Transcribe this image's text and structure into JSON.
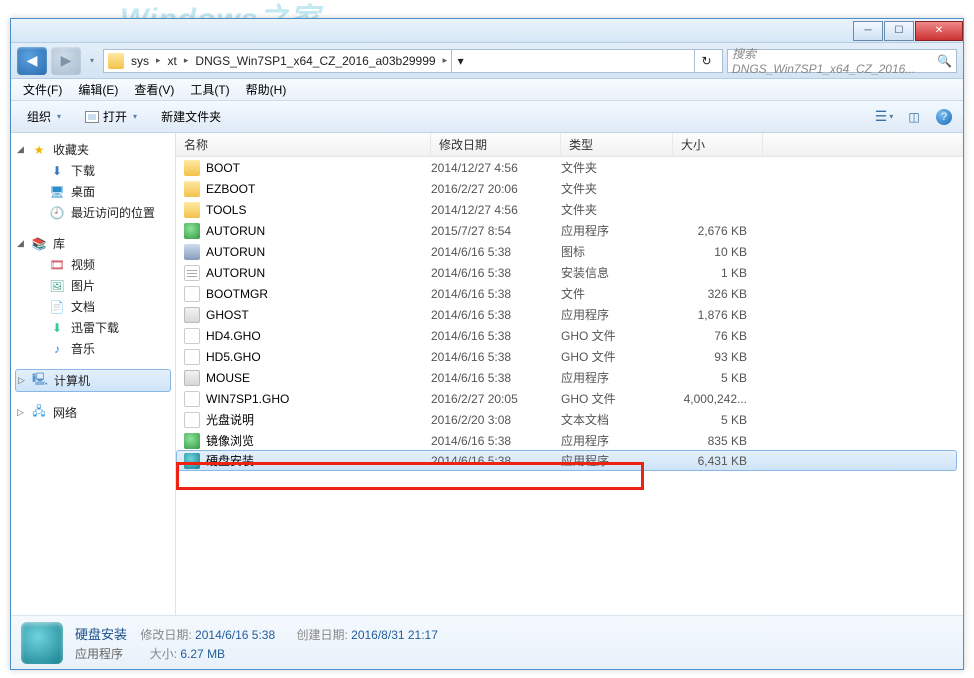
{
  "backdrop1": "Windows之家",
  "titlebar": {
    "min": "─",
    "max": "☐",
    "close": "✕"
  },
  "nav": {
    "back": "◀",
    "forward": "▶",
    "drop": "▾",
    "refresh": "↻",
    "search_placeholder": "搜索 DNGS_Win7SP1_x64_CZ_2016..."
  },
  "breadcrumb": {
    "items": [
      "sys",
      "xt",
      "DNGS_Win7SP1_x64_CZ_2016_a03b29999"
    ],
    "sep": "▸"
  },
  "menubar": {
    "file": "文件(F)",
    "edit": "编辑(E)",
    "view": "查看(V)",
    "tools": "工具(T)",
    "help": "帮助(H)"
  },
  "toolbar": {
    "organize": "组织",
    "open": "打开",
    "newfolder": "新建文件夹",
    "view_drop": "▾",
    "help": "?"
  },
  "sidebar": {
    "favorites": "收藏夹",
    "downloads": "下载",
    "desktop": "桌面",
    "recent": "最近访问的位置",
    "libraries": "库",
    "videos": "视频",
    "pictures": "图片",
    "documents": "文档",
    "xunlei": "迅雷下载",
    "music": "音乐",
    "computer": "计算机",
    "network": "网络",
    "tw_open": "◢",
    "tw_closed": "▷"
  },
  "columns": {
    "name": "名称",
    "date": "修改日期",
    "type": "类型",
    "size": "大小"
  },
  "rows": [
    {
      "icon": "fi-folder",
      "name": "BOOT",
      "date": "2014/12/27 4:56",
      "type": "文件夹",
      "size": ""
    },
    {
      "icon": "fi-folder",
      "name": "EZBOOT",
      "date": "2016/2/27 20:06",
      "type": "文件夹",
      "size": ""
    },
    {
      "icon": "fi-folder",
      "name": "TOOLS",
      "date": "2014/12/27 4:56",
      "type": "文件夹",
      "size": ""
    },
    {
      "icon": "fi-exe-green",
      "name": "AUTORUN",
      "date": "2015/7/27 8:54",
      "type": "应用程序",
      "size": "2,676 KB"
    },
    {
      "icon": "fi-ico",
      "name": "AUTORUN",
      "date": "2014/6/16 5:38",
      "type": "图标",
      "size": "10 KB"
    },
    {
      "icon": "fi-ini",
      "name": "AUTORUN",
      "date": "2014/6/16 5:38",
      "type": "安装信息",
      "size": "1 KB"
    },
    {
      "icon": "fi-file",
      "name": "BOOTMGR",
      "date": "2014/6/16 5:38",
      "type": "文件",
      "size": "326 KB"
    },
    {
      "icon": "fi-exe",
      "name": "GHOST",
      "date": "2014/6/16 5:38",
      "type": "应用程序",
      "size": "1,876 KB"
    },
    {
      "icon": "fi-gho",
      "name": "HD4.GHO",
      "date": "2014/6/16 5:38",
      "type": "GHO 文件",
      "size": "76 KB"
    },
    {
      "icon": "fi-gho",
      "name": "HD5.GHO",
      "date": "2014/6/16 5:38",
      "type": "GHO 文件",
      "size": "93 KB"
    },
    {
      "icon": "fi-exe",
      "name": "MOUSE",
      "date": "2014/6/16 5:38",
      "type": "应用程序",
      "size": "5 KB"
    },
    {
      "icon": "fi-gho",
      "name": "WIN7SP1.GHO",
      "date": "2016/2/27 20:05",
      "type": "GHO 文件",
      "size": "4,000,242..."
    },
    {
      "icon": "fi-txt",
      "name": "光盘说明",
      "date": "2016/2/20 3:08",
      "type": "文本文档",
      "size": "5 KB"
    },
    {
      "icon": "fi-exe-green",
      "name": "镜像浏览",
      "date": "2014/6/16 5:38",
      "type": "应用程序",
      "size": "835 KB"
    },
    {
      "icon": "fi-app-teal",
      "name": "硬盘安装",
      "date": "2014/6/16 5:38",
      "type": "应用程序",
      "size": "6,431 KB",
      "selected": true
    }
  ],
  "details": {
    "filename": "硬盘安装",
    "filetype": "应用程序",
    "mod_label": "修改日期:",
    "mod_val": "2014/6/16 5:38",
    "create_label": "创建日期:",
    "create_val": "2016/8/31 21:17",
    "size_label": "大小:",
    "size_val": "6.27 MB"
  }
}
